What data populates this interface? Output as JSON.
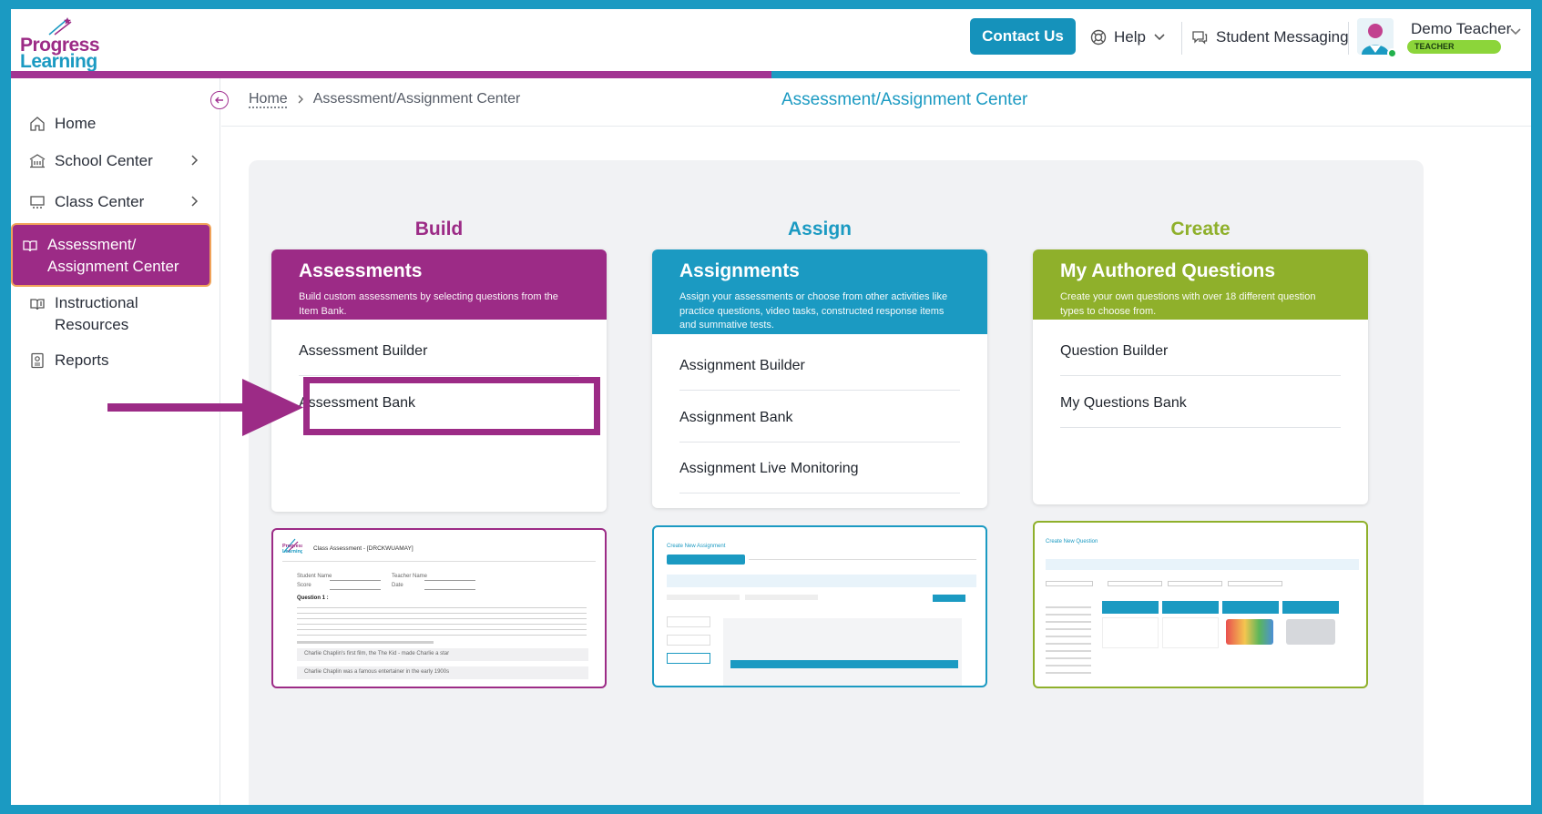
{
  "header": {
    "logo_top": "Progress",
    "logo_bottom": "Learning",
    "contact_label": "Contact Us",
    "help_label": "Help",
    "messaging_label": "Student Messaging",
    "user_name": "Demo Teacher",
    "user_role": "TEACHER"
  },
  "sidebar": {
    "items": [
      {
        "label": "Home",
        "icon": "home-icon"
      },
      {
        "label": "School Center",
        "icon": "school-icon"
      },
      {
        "label": "Class Center",
        "icon": "class-icon"
      },
      {
        "label_line1": "Assessment/",
        "label_line2": "Assignment Center",
        "icon": "book-icon",
        "active": true
      },
      {
        "label_line1": "Instructional",
        "label_line2": "Resources",
        "icon": "resources-icon"
      },
      {
        "label": "Reports",
        "icon": "reports-icon"
      }
    ]
  },
  "breadcrumb": {
    "home": "Home",
    "current": "Assessment/Assignment Center"
  },
  "page_title": "Assessment/Assignment Center",
  "columns": [
    {
      "label": "Build",
      "color": "#9c2b86",
      "card_title": "Assessments",
      "card_desc": "Build custom assessments by selecting questions from the Item Bank.",
      "links": [
        "Assessment Builder",
        "Assessment Bank"
      ]
    },
    {
      "label": "Assign",
      "color": "#1b9ac2",
      "card_title": "Assignments",
      "card_desc": "Assign your assessments or choose from other activities like practice questions, video tasks, constructed response items and summative tests.",
      "links": [
        "Assignment Builder",
        "Assignment Bank",
        "Assignment Live Monitoring"
      ]
    },
    {
      "label": "Create",
      "color": "#8fb02b",
      "card_title": "My Authored Questions",
      "card_desc": "Create your own questions with over 18 different question types to choose from.",
      "links": [
        "Question Builder",
        "My Questions Bank"
      ]
    }
  ],
  "thumbnails": {
    "build_title": "Class Assessment - [DRCKWUAMAY]",
    "build_student": "Student Name",
    "build_teacher": "Teacher Name",
    "build_score": "Score",
    "build_date": "Date",
    "build_question": "Question 1 :",
    "build_option_a": "Charlie Chaplin's first film, the The Kid - made Charlie a star",
    "build_option_b": "Charlie Chaplin was a famous entertainer in the early 1900s",
    "assign_title": "Create New Assignment",
    "create_title": "Create New Question"
  }
}
